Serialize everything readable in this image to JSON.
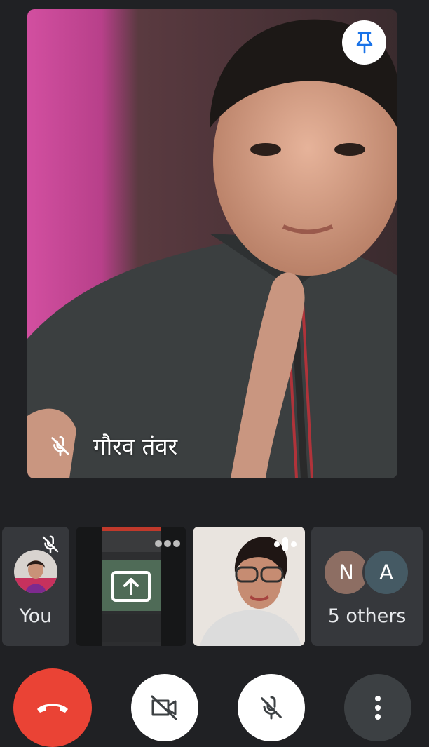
{
  "main_participant": {
    "name": "गौरव तंवर",
    "muted_icon": "mic-off-icon",
    "pin_icon": "pin-icon"
  },
  "participants": {
    "self": {
      "label": "You",
      "muted_icon": "mic-off-icon"
    },
    "presentation": {
      "icon": "present-screen-icon",
      "menu_icon": "more-dots-icon"
    },
    "camera": {
      "speaking_icon": "audio-level-icon"
    },
    "others": {
      "avatars": [
        {
          "initial": "N",
          "color": "#8d6e63"
        },
        {
          "initial": "A",
          "color": "#455a64"
        }
      ],
      "label": "5 others"
    }
  },
  "controls": {
    "end_call_icon": "end-call-icon",
    "camera_icon": "camera-off-icon",
    "mic_icon": "mic-off-icon",
    "more_icon": "more-vert-icon"
  },
  "colors": {
    "background": "#202124",
    "end_call": "#ea4335",
    "tile": "#36383c"
  }
}
